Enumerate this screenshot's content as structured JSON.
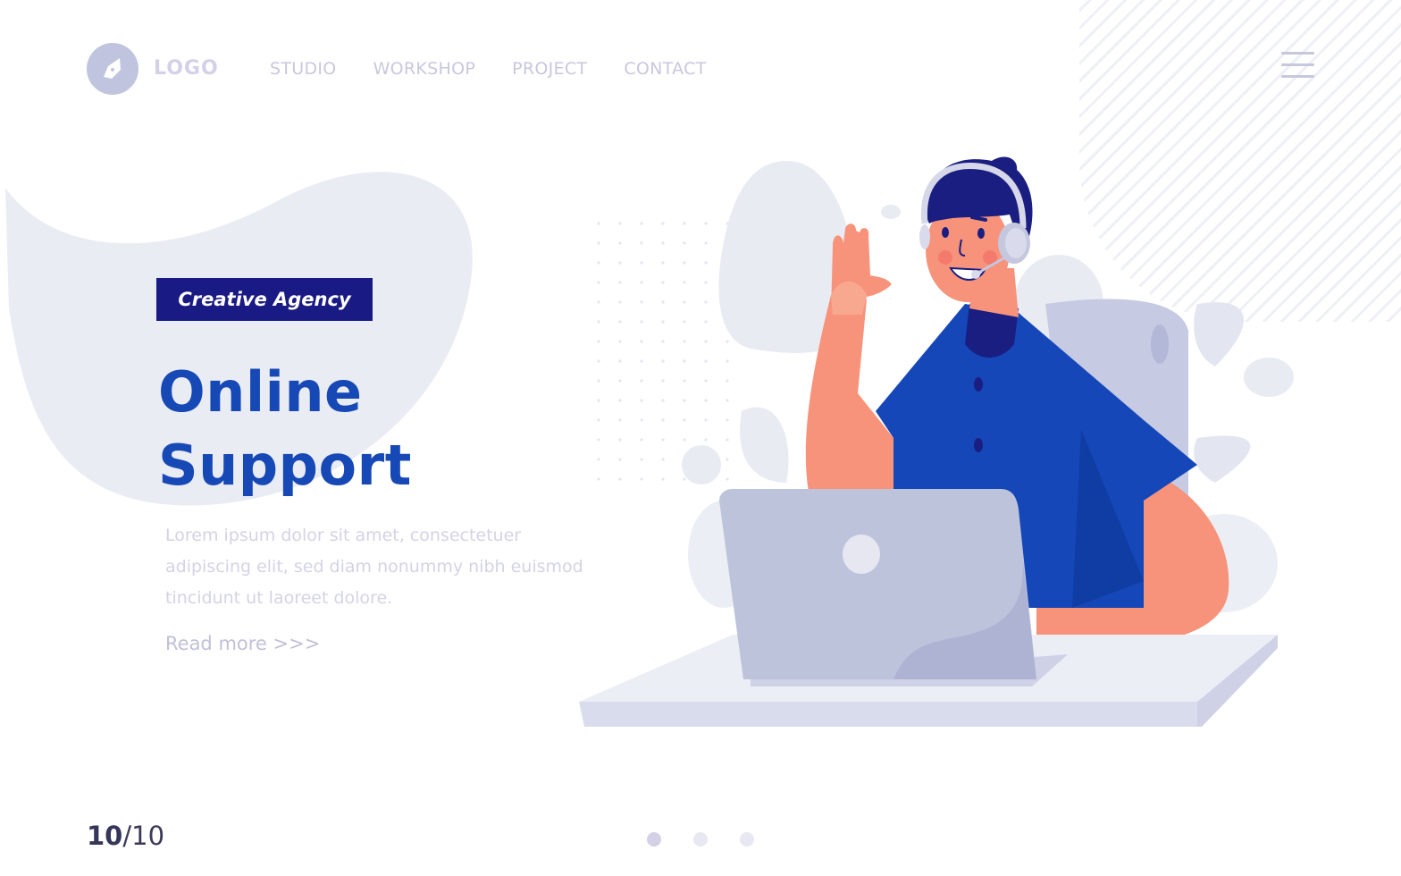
{
  "header": {
    "logo_text": "LOGO",
    "logo_icon": "pen-nib-icon",
    "nav": [
      {
        "label": "STUDIO"
      },
      {
        "label": "WORKSHOP"
      },
      {
        "label": "PROJECT"
      },
      {
        "label": "CONTACT"
      }
    ],
    "menu_icon": "hamburger-menu-icon"
  },
  "hero": {
    "badge": "Creative Agency",
    "title_line1": "Online",
    "title_line2": "Support",
    "description": "Lorem ipsum dolor sit amet, consectetuer adipiscing elit, sed diam nonummy nibh euismod tincidunt ut laoreet dolore.",
    "read_more": "Read more >>>"
  },
  "footer": {
    "page_current": "10",
    "page_separator": "/",
    "page_total": "10",
    "slide_dots": 3,
    "active_dot": 1
  },
  "colors": {
    "primary_blue": "#1648b6",
    "badge_navy": "#1a1a84",
    "skin": "#f7937a",
    "shirt": "#1446b8",
    "laptop": "#bec3dc",
    "muted_text": "#d4d3e6"
  }
}
